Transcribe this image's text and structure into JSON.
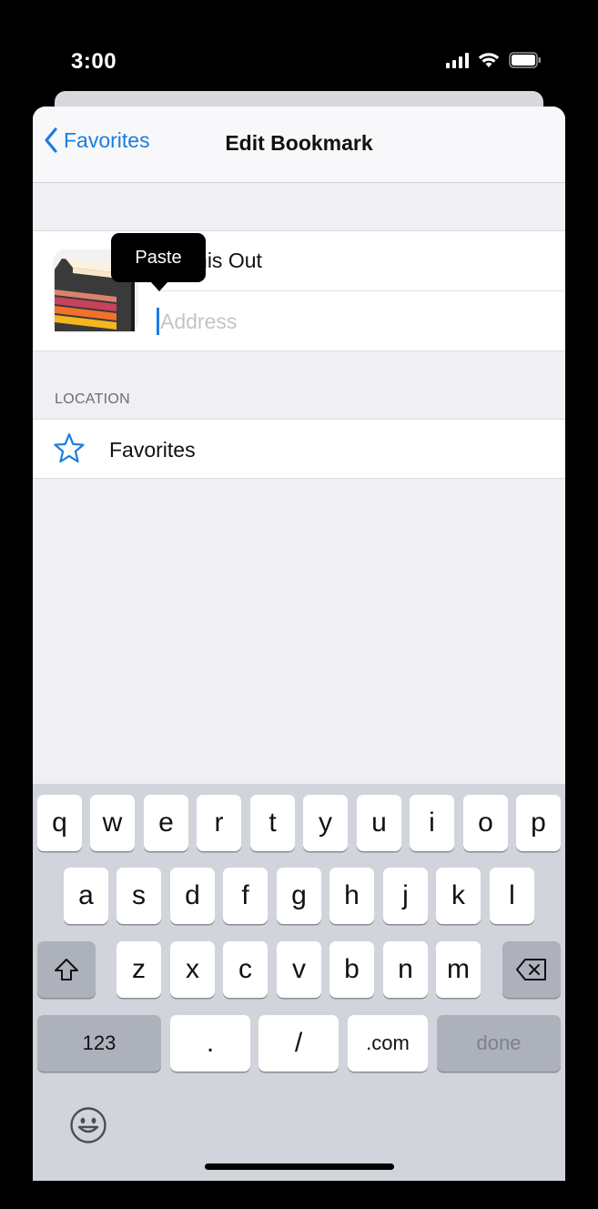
{
  "status": {
    "time": "3:00"
  },
  "nav": {
    "back_label": "Favorites",
    "title": "Edit Bookmark"
  },
  "bookmark": {
    "title_value": "ck This Out",
    "address_placeholder": "Address",
    "address_value": ""
  },
  "tooltip": {
    "label": "Paste"
  },
  "location": {
    "section_header": "LOCATION",
    "folder_label": "Favorites"
  },
  "keyboard": {
    "row1": [
      "q",
      "w",
      "e",
      "r",
      "t",
      "y",
      "u",
      "i",
      "o",
      "p"
    ],
    "row2": [
      "a",
      "s",
      "d",
      "f",
      "g",
      "h",
      "j",
      "k",
      "l"
    ],
    "row3": [
      "z",
      "x",
      "c",
      "v",
      "b",
      "n",
      "m"
    ],
    "numbers_label": "123",
    "dot_label": ".",
    "slash_label": "/",
    "com_label": ".com",
    "done_label": "done"
  },
  "colors": {
    "accent": "#1a7de0",
    "keyboard_bg": "#d1d4db"
  }
}
